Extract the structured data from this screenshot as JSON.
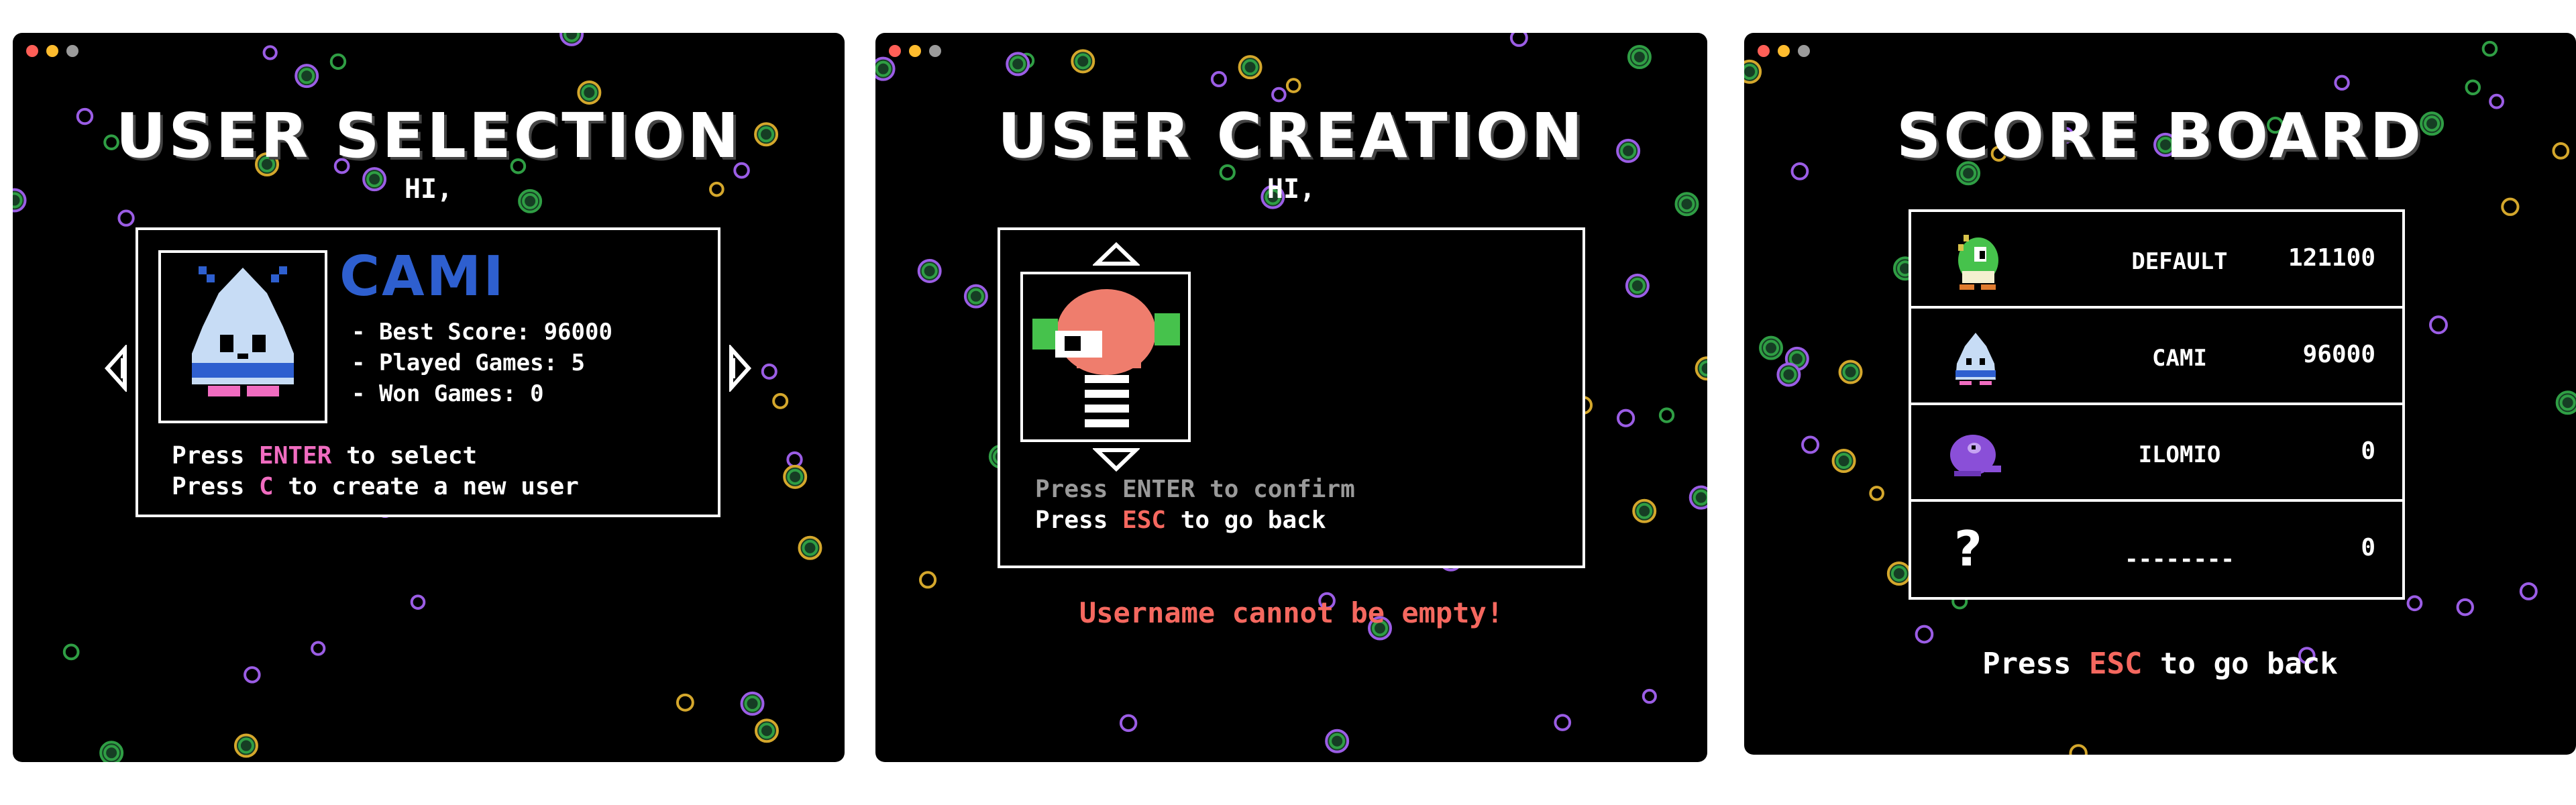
{
  "colors": {
    "close": "#ff5f57",
    "minimize": "#febc2e",
    "maximize": "#9b9b9b",
    "username": "#2e5fcf",
    "enter_highlight": "#f06cc0",
    "esc_highlight": "#f5685f",
    "error": "#f5685f"
  },
  "user_selection": {
    "title": "USER SELECTION",
    "greeting": "HI,",
    "username": "CAMI",
    "stats": [
      "- Best Score: 96000",
      "- Played Games: 5",
      "- Won Games: 0"
    ],
    "instr1": {
      "pre": "Press ",
      "key": "ENTER",
      "post": " to select"
    },
    "instr2": {
      "pre": "Press ",
      "key": "C",
      "post": " to create a new user"
    },
    "icons": {
      "prev": "left-arrow-icon",
      "next": "right-arrow-icon",
      "avatar": "blue-ghost-avatar-icon"
    }
  },
  "user_creation": {
    "title": "USER CREATION",
    "greeting": "HI,",
    "confirm": {
      "text": "Press ENTER to confirm"
    },
    "back": {
      "pre": "Press ",
      "key": "ESC",
      "post": " to go back"
    },
    "error": "Username cannot be empty!",
    "icons": {
      "up": "up-arrow-icon",
      "down": "down-arrow-icon",
      "avatar": "red-creature-avatar-icon"
    }
  },
  "score_board": {
    "title": "SCORE BOARD",
    "rows": [
      {
        "name": "DEFAULT",
        "score": "121100",
        "icon": "green-dragon-icon"
      },
      {
        "name": "CAMI",
        "score": "96000",
        "icon": "blue-ghost-icon"
      },
      {
        "name": "ILOMIO",
        "score": "0",
        "icon": "purple-whale-icon"
      },
      {
        "name": "--------",
        "score": "0",
        "icon": "question-mark-icon",
        "glyph": "?"
      }
    ],
    "back": {
      "pre": "Press ",
      "key": "ESC",
      "post": " to go back"
    }
  }
}
